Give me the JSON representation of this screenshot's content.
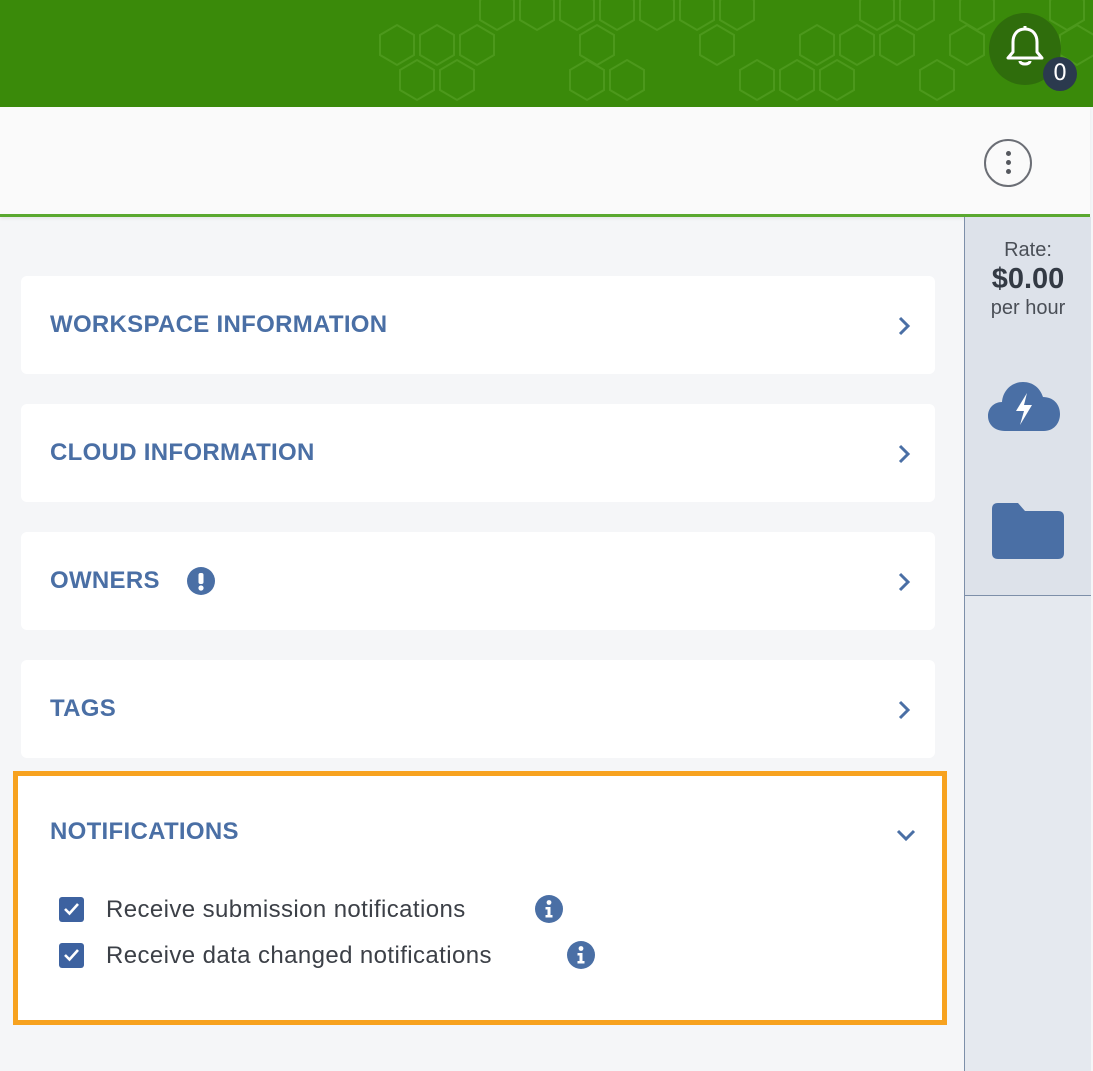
{
  "topbar": {
    "notification_icon": "bell-icon",
    "notification_count": "0",
    "brand_color": "#3a8a0a"
  },
  "header": {
    "menu_icon": "kebab-menu-icon"
  },
  "sidepanel": {
    "rate_label": "Rate:",
    "rate_value": "$0.00",
    "rate_unit": "per hour",
    "icons": [
      "cloud-bolt-icon",
      "folder-icon"
    ]
  },
  "sections": [
    {
      "title": "WORKSPACE INFORMATION",
      "expanded": false
    },
    {
      "title": "CLOUD INFORMATION",
      "expanded": false
    },
    {
      "title": "OWNERS",
      "expanded": false,
      "badge_icon": "exclamation-circle-icon"
    },
    {
      "title": "TAGS",
      "expanded": false
    }
  ],
  "notifications": {
    "title": "NOTIFICATIONS",
    "expanded": true,
    "options": [
      {
        "label": "Receive submission notifications",
        "checked": true
      },
      {
        "label": "Receive data changed notifications",
        "checked": true
      }
    ]
  },
  "colors": {
    "accent": "#4a6fa5",
    "highlight": "#f7a21f",
    "header_border": "#5aa830"
  }
}
